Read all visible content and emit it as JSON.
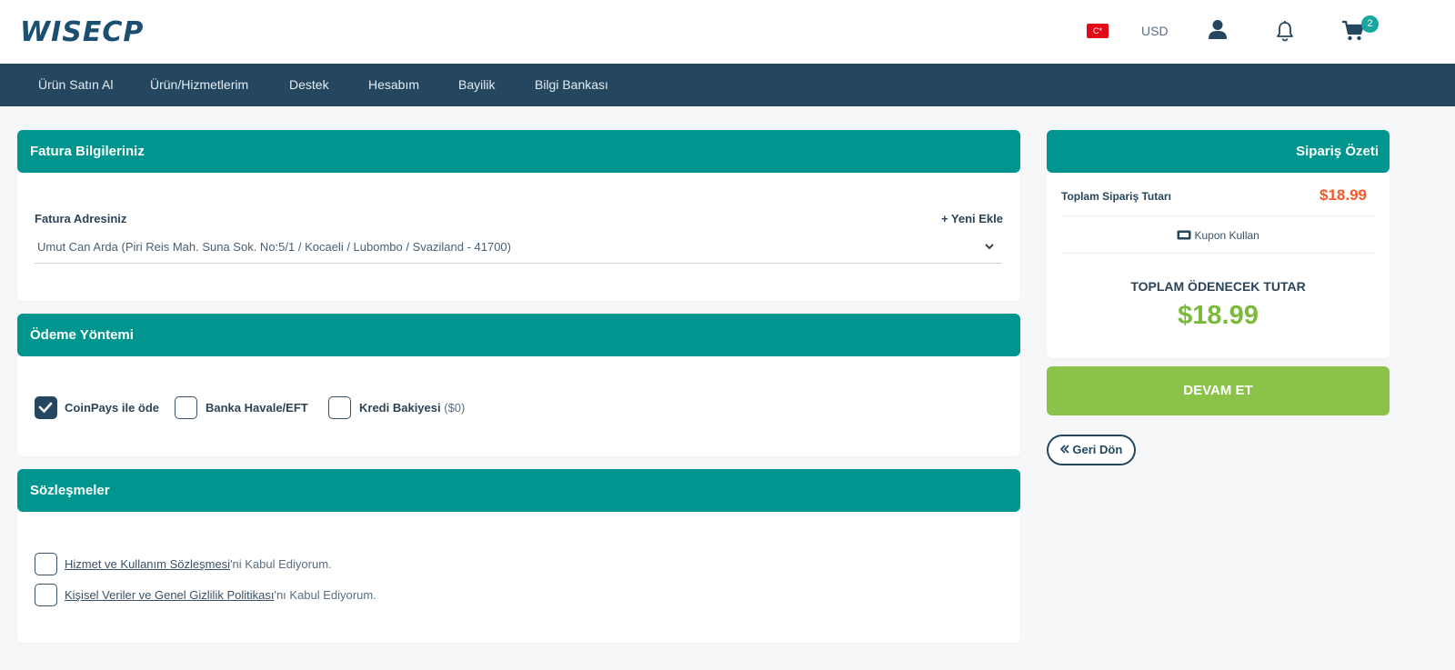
{
  "brand": {
    "logo": "WISECP"
  },
  "header": {
    "flag": "C*",
    "currency": "USD",
    "cart_count": "2"
  },
  "nav": [
    {
      "label": "Ürün Satın Al"
    },
    {
      "label": "Ürün/Hizmetlerim"
    },
    {
      "label": "Destek"
    },
    {
      "label": "Hesabım"
    },
    {
      "label": "Bayilik"
    },
    {
      "label": "Bilgi Bankası"
    }
  ],
  "invoice": {
    "title": "Fatura Bilgileriniz",
    "address_label": "Fatura Adresiniz",
    "add_new": "+ Yeni Ekle",
    "address_value": "Umut Can Arda (Piri Reis Mah. Suna Sok. No:5/1 / Kocaeli / Lubombo / Svaziland - 41700)"
  },
  "payment": {
    "title": "Ödeme Yöntemi",
    "options": [
      {
        "label": "CoinPays ile öde",
        "extra": "",
        "checked": true
      },
      {
        "label": "Banka Havale/EFT",
        "extra": "",
        "checked": false
      },
      {
        "label": "Kredi Bakiyesi",
        "extra": "($0)",
        "checked": false
      }
    ]
  },
  "agreements": {
    "title": "Sözleşmeler",
    "items": [
      {
        "link": "Hizmet ve Kullanım Sözleşmesi",
        "suffix": "'ni Kabul Ediyorum."
      },
      {
        "link": "Kişisel Veriler ve Genel Gizlilik Politikası",
        "suffix": "'nı Kabul Ediyorum."
      }
    ]
  },
  "summary": {
    "title": "Sipariş Özeti",
    "total_label": "Toplam Sipariş Tutarı",
    "total_value": "$18.99",
    "coupon": "Kupon Kullan",
    "payable_label": "TOPLAM ÖDENECEK TUTAR",
    "payable_value": "$18.99",
    "continue": "DEVAM ET",
    "back": "Geri Dön"
  },
  "colors": {
    "teal": "#00968f",
    "navy": "#24475f",
    "green": "#8bc34a",
    "price_orange": "#f05a28",
    "payable_green": "#7cba3b"
  }
}
